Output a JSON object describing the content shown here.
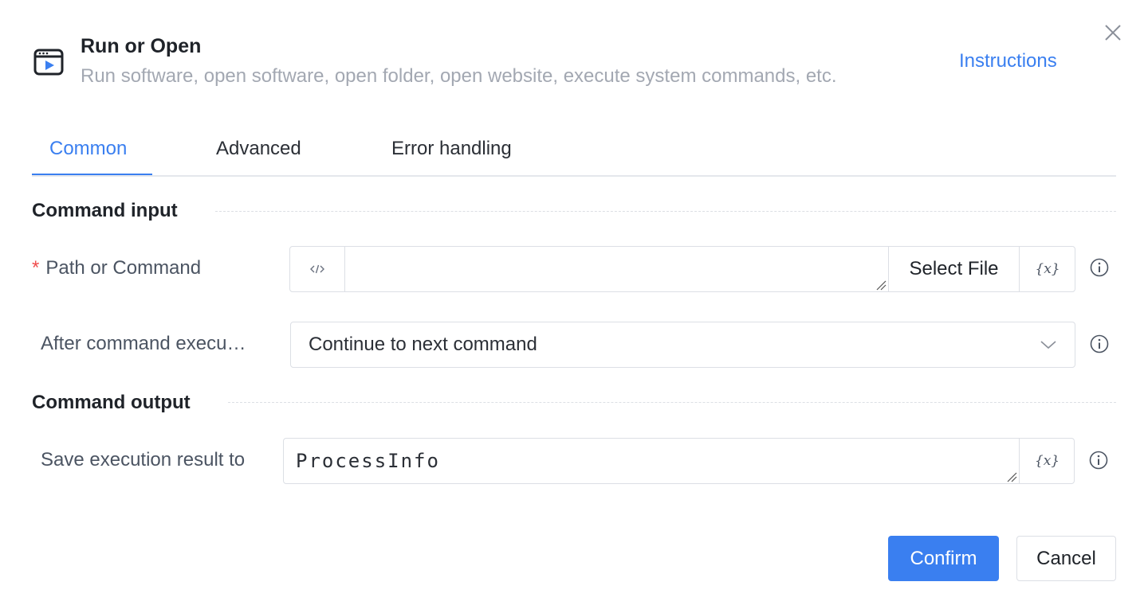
{
  "header": {
    "title": "Run or Open",
    "subtitle": "Run software, open software, open folder, open website, execute system commands, etc.",
    "instructions_label": "Instructions",
    "app_icon": "window-play-icon",
    "close_icon": "close-icon"
  },
  "tabs": [
    {
      "label": "Common",
      "active": true
    },
    {
      "label": "Advanced",
      "active": false
    },
    {
      "label": "Error handling",
      "active": false
    }
  ],
  "sections": {
    "input_title": "Command input",
    "output_title": "Command output"
  },
  "fields": {
    "path": {
      "required_mark": "*",
      "label": "Path or Command",
      "value": "",
      "code_icon": "code-icon",
      "select_file_label": "Select File",
      "variable_label": "{x}"
    },
    "after": {
      "label": "After command execu…",
      "value": "Continue to next command"
    },
    "save": {
      "label": "Save execution result to",
      "value": "ProcessInfo",
      "variable_label": "{x}"
    }
  },
  "footer": {
    "confirm_label": "Confirm",
    "cancel_label": "Cancel"
  },
  "colors": {
    "accent": "#3a7ff0",
    "required": "#f04d4d",
    "muted_text": "#a3a8b2"
  }
}
